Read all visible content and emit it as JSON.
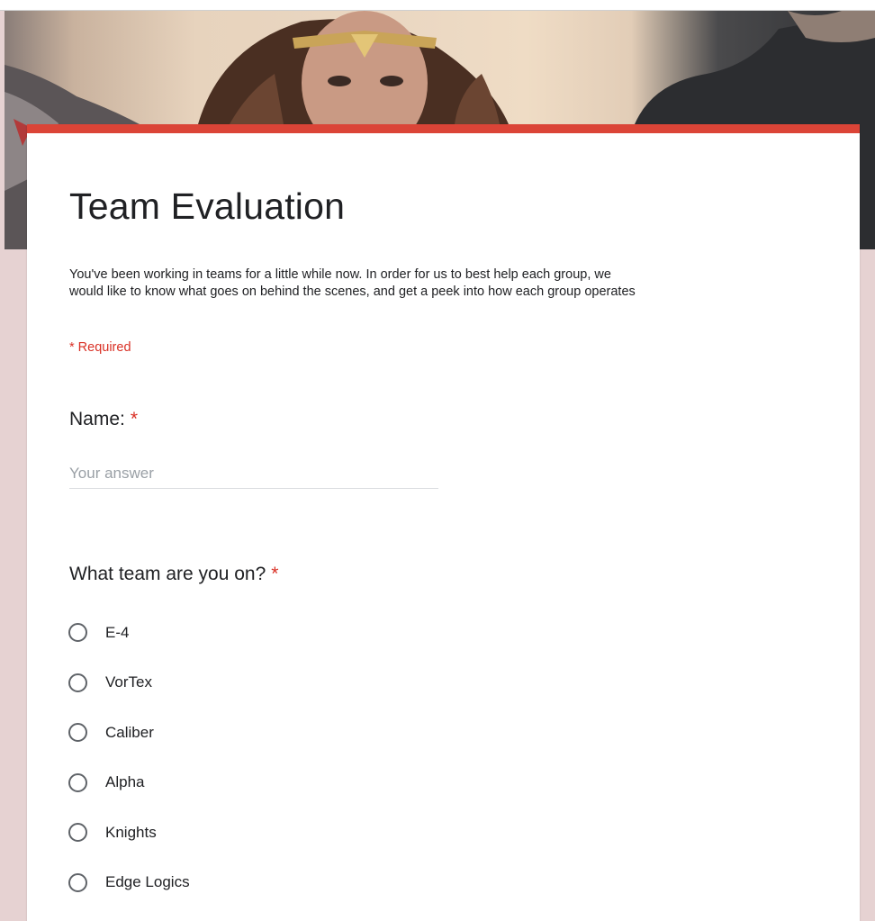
{
  "form": {
    "title": "Team Evaluation",
    "description_lines": [
      "You've been working in teams for a little while now.  In order for us to best help each group, we",
      "would like to know what goes on behind the scenes, and get a peek into how each group operates"
    ],
    "required_note": "* Required",
    "accent_color": "#db4437",
    "background_color": "#e6d2d2"
  },
  "questions": {
    "name": {
      "label": "Name:",
      "required_mark": "*",
      "placeholder": "Your answer"
    },
    "team": {
      "label": "What team are you on?",
      "required_mark": "*",
      "options": [
        "E-4",
        "VorTex",
        "Caliber",
        "Alpha",
        "Knights",
        "Edge Logics"
      ]
    }
  }
}
